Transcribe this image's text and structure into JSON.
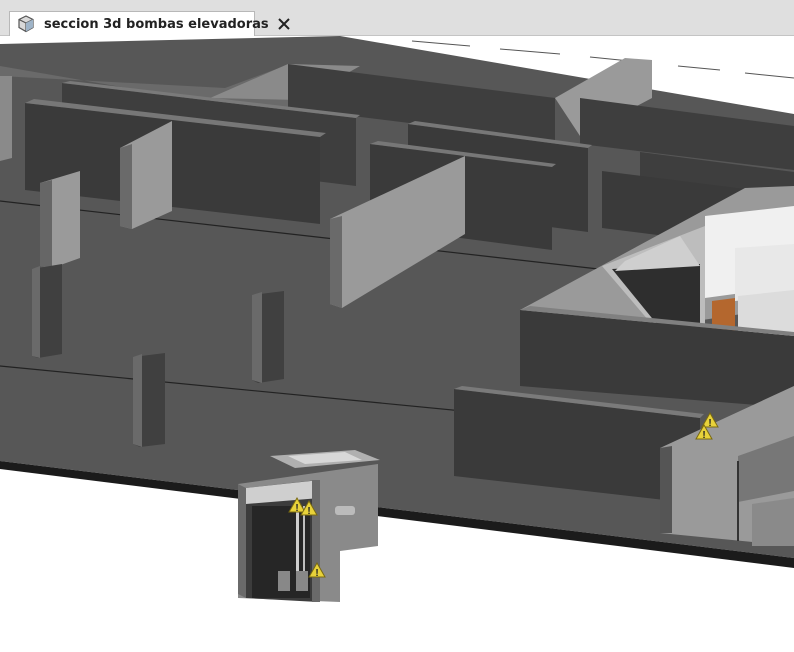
{
  "tab": {
    "title": "seccion 3d bombas elevadoras",
    "icon": "3d-view-icon",
    "close_icon": "close-icon"
  },
  "view": {
    "kind": "3d-view",
    "warning_icon": "warning-icon",
    "warning_count": 5
  },
  "colors": {
    "tabbar": "#dfdfdf",
    "floor": "#575757",
    "wall_dark": "#3a3a3a",
    "wall_light": "#9a9a9a",
    "warning": "#e8d23a"
  }
}
